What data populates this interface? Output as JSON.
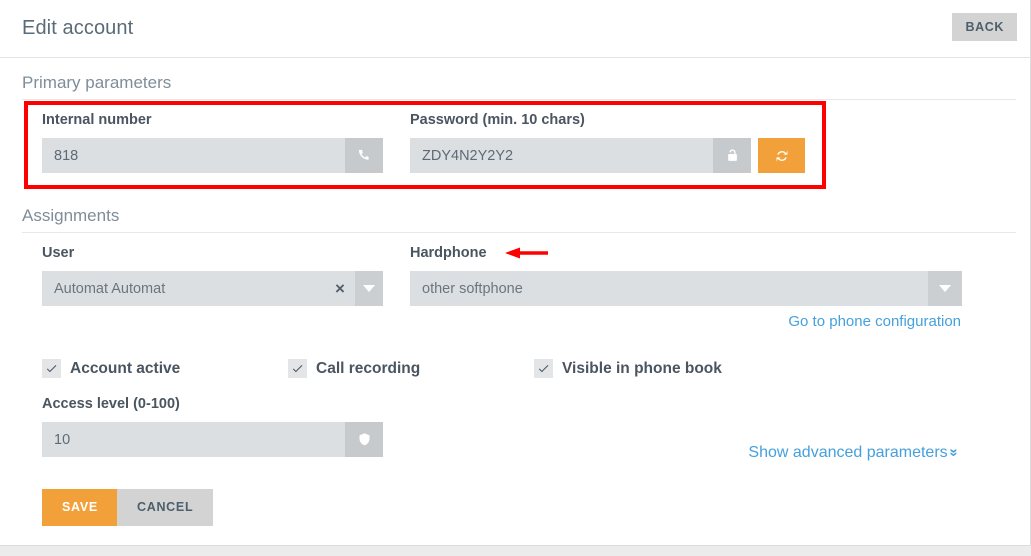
{
  "header": {
    "title": "Edit account",
    "back_label": "BACK"
  },
  "sections": {
    "primary": {
      "heading": "Primary parameters",
      "internal_number": {
        "label": "Internal number",
        "value": "818",
        "addon_icon": "phone-icon"
      },
      "password": {
        "label": "Password (min. 10 chars)",
        "value": "ZDY4N2Y2Y2",
        "addon_icon": "unlock-icon",
        "regenerate_icon": "refresh-icon"
      }
    },
    "assignments": {
      "heading": "Assignments",
      "user": {
        "label": "User",
        "value": "Automat Automat",
        "clear_glyph": "×"
      },
      "hardphone": {
        "label": "Hardphone",
        "value": "other softphone"
      },
      "phone_config_link": "Go to phone configuration",
      "checkboxes": [
        {
          "label": "Account active",
          "checked": true
        },
        {
          "label": "Call recording",
          "checked": true
        },
        {
          "label": "Visible in phone book",
          "checked": true
        }
      ],
      "access_level": {
        "label": "Access level (0-100)",
        "value": "10",
        "addon_icon": "shield-icon"
      },
      "advanced_link": "Show advanced parameters",
      "advanced_chevron": "»"
    }
  },
  "footer": {
    "save_label": "SAVE",
    "cancel_label": "CANCEL"
  },
  "annotations": {
    "highlight_color": "#fd0000",
    "arrow_target": "Hardphone"
  },
  "theme": {
    "accent": "#f2a13a",
    "link": "#45a0dd",
    "input_bg": "#dcdfe1",
    "label": "#4a5560"
  }
}
